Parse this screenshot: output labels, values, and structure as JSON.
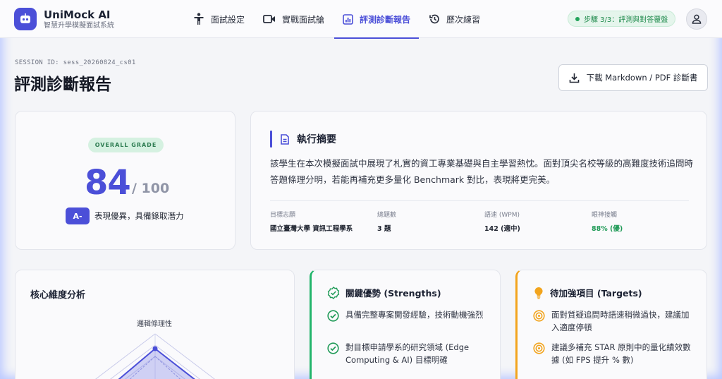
{
  "app": {
    "title": "UniMock AI",
    "subtitle": "智慧升學模擬面試系統"
  },
  "nav": {
    "items": [
      {
        "label": "面試設定",
        "icon": "person-icon"
      },
      {
        "label": "實戰面試艙",
        "icon": "video-camera-icon"
      },
      {
        "label": "評測診斷報告",
        "icon": "bar-chart-icon",
        "active": true
      },
      {
        "label": "歷次練習",
        "icon": "history-icon"
      }
    ]
  },
  "step": {
    "label": "步驟 3/3：評測與對答覆盤"
  },
  "session": {
    "id_label": "SESSION ID: sess_20260824_cs01"
  },
  "page": {
    "title": "評測診斷報告"
  },
  "download": {
    "label": "下載 Markdown / PDF 診斷書"
  },
  "grade": {
    "badge": "OVERALL GRADE",
    "score": "84",
    "total": "/ 100",
    "letter": "A-",
    "description": "表現優異，具備錄取潛力"
  },
  "summary": {
    "title": "執行摘要",
    "text": "該學生在本次模擬面試中展現了札實的資工專業基礎與自主學習熱忱。面對頂尖名校等級的高難度技術追問時答題條理分明，若能再補充更多量化 Benchmark 對比，表現將更完美。",
    "stats": [
      {
        "label": "目標志願",
        "value": "國立臺灣大學 資訊工程學系"
      },
      {
        "label": "總題數",
        "value": "3 題"
      },
      {
        "label": "語速 (WPM)",
        "value": "142 (適中)"
      },
      {
        "label": "眼神接觸",
        "value": "88% (優)"
      }
    ]
  },
  "radar": {
    "title": "核心維度分析",
    "axis_top": "邏輯條理性"
  },
  "strengths": {
    "title": "關鍵優勢 (Strengths)",
    "items": [
      "具備完整專案開發經驗，技術動機強烈",
      "對目標申請學系的研究領域 (Edge Computing & AI) 目標明確"
    ]
  },
  "targets": {
    "title": "待加強項目 (Targets)",
    "items": [
      "面對質疑追問時語速稍微過快，建議加入適度停頓",
      "建議多補充 STAR 原則中的量化績效數據 (如 FPS 提升 % 數)"
    ]
  },
  "colors": {
    "accent": "#4b4fd8",
    "success": "#22b56b",
    "warning": "#f2a41d"
  }
}
